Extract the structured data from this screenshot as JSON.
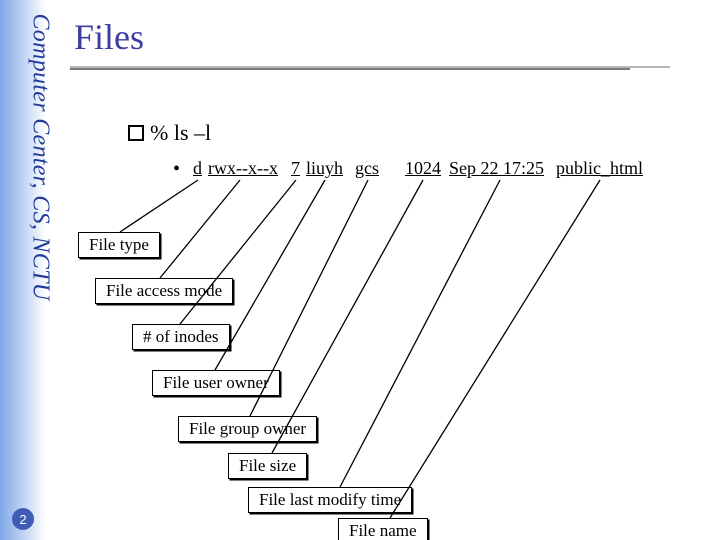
{
  "sidebar": {
    "org_text": "Computer Center, CS, NCTU"
  },
  "slide": {
    "number": "2",
    "title": "Files"
  },
  "command": {
    "bullet_glyph": "",
    "text": "% ls –l",
    "dot": "•"
  },
  "output": {
    "d": "d",
    "perm": "rwx--x--x",
    "inodes": "7",
    "user": "liuyh",
    "group": "gcs",
    "size": "1024",
    "date": "Sep 22 17:25",
    "name": "public_html"
  },
  "labels": {
    "file_type": "File type",
    "access_mode": "File access mode",
    "inodes": "# of inodes",
    "user_owner": "File user owner",
    "group_owner": "File group owner",
    "size": "File size",
    "mtime": "File last modify time",
    "name": "File name"
  }
}
